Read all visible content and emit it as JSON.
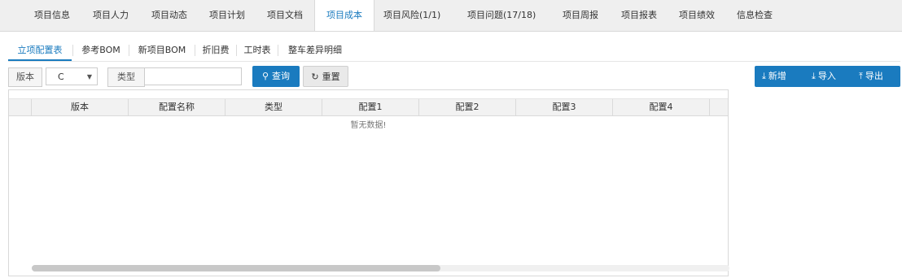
{
  "topnav": {
    "items": [
      {
        "label": "项目信息"
      },
      {
        "label": "项目人力"
      },
      {
        "label": "项目动态"
      },
      {
        "label": "项目计划"
      },
      {
        "label": "项目文档"
      },
      {
        "label": "项目成本"
      },
      {
        "label": "项目风险(1/1)"
      },
      {
        "label": "项目问题(17/18)"
      },
      {
        "label": "项目周报"
      },
      {
        "label": "项目报表"
      },
      {
        "label": "项目绩效"
      },
      {
        "label": "信息检查"
      }
    ],
    "active_index": 5
  },
  "subtabs": {
    "items": [
      {
        "label": "立项配置表"
      },
      {
        "label": "参考BOM"
      },
      {
        "label": "新项目BOM"
      },
      {
        "label": "折旧费"
      },
      {
        "label": "工时表"
      },
      {
        "label": "整车差异明细"
      }
    ]
  },
  "filter": {
    "version_label": "版本",
    "version_value": "C",
    "type_label": "类型",
    "type_value": "",
    "search_label": "查询",
    "reset_label": "重置"
  },
  "actions": {
    "add_label": "新增",
    "import_label": "导入",
    "export_label": "导出"
  },
  "table": {
    "columns": [
      "版本",
      "配置名称",
      "类型",
      "配置1",
      "配置2",
      "配置3",
      "配置4"
    ],
    "empty_text": "暂无数据!"
  },
  "colors": {
    "accent": "#1a7bbf",
    "nav_bg": "#efefef"
  }
}
